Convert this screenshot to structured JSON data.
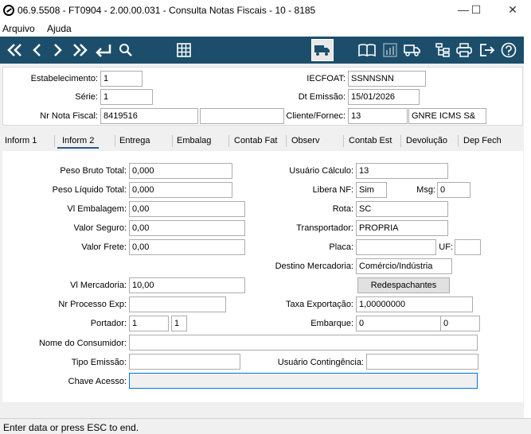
{
  "window": {
    "title": "06.9.5508 - FT0904 - 2.00.00.031 - Consulta Notas Fiscais - 10 - 8185",
    "minimize": "—",
    "maximize": "☐",
    "close": "✕"
  },
  "menu": {
    "arquivo": "Arquivo",
    "ajuda": "Ajuda"
  },
  "header": {
    "estabelecimento_label": "Estabelecimento:",
    "estabelecimento": "1",
    "serie_label": "Série:",
    "serie": "1",
    "nr_nota_label": "Nr Nota Fiscal:",
    "nr_nota": "8419516",
    "nr_nota_extra": "",
    "iecfoat_label": "IECFOAT:",
    "iecfoat": "SSNNSNN",
    "dt_emissao_label": "Dt Emissão:",
    "dt_emissao": "15/01/2026",
    "cliente_label": "Cliente/Fornec:",
    "cliente_code": "13",
    "cliente_name": "GNRE ICMS S&"
  },
  "tabs": [
    "Inform 1",
    "Inform 2",
    "Entrega",
    "Embalag",
    "Contab Fat",
    "Observ",
    "Contab Est",
    "Devolução",
    "Dep Fech"
  ],
  "form": {
    "peso_bruto_label": "Peso Bruto Total:",
    "peso_bruto": "0,000",
    "peso_liquido_label": "Peso Líquido Total:",
    "peso_liquido": "0,000",
    "vl_embalagem_label": "Vl Embalagem:",
    "vl_embalagem": "0,00",
    "valor_seguro_label": "Valor Seguro:",
    "valor_seguro": "0,00",
    "valor_frete_label": "Valor Frete:",
    "valor_frete": "0,00",
    "vl_mercadoria_label": "Vl Mercadoria:",
    "vl_mercadoria": "10,00",
    "nr_processo_label": "Nr Processo Exp:",
    "nr_processo": "",
    "portador_label": "Portador:",
    "portador_1": "1",
    "portador_2": "1",
    "nome_consumidor_label": "Nome do Consumidor:",
    "nome_consumidor": "",
    "tipo_emissao_label": "Tipo Emissão:",
    "tipo_emissao": "",
    "chave_acesso_label": "Chave Acesso:",
    "chave_acesso": "",
    "usuario_calculo_label": "Usuário Cálculo:",
    "usuario_calculo": "13",
    "libera_nf_label": "Libera NF:",
    "libera_nf": "Sim",
    "msg_label": "Msg:",
    "msg": "0",
    "rota_label": "Rota:",
    "rota": "SC",
    "transportador_label": "Transportador:",
    "transportador": "PROPRIA",
    "placa_label": "Placa:",
    "placa": "",
    "uf_label": "UF:",
    "uf": "",
    "destino_label": "Destino Mercadoria:",
    "destino": "Comércio/Indústria",
    "redespachantes_button": "Redespachantes",
    "taxa_exportacao_label": "Taxa Exportação:",
    "taxa_exportacao": "1,00000000",
    "embarque_label": "Embarque:",
    "embarque_1": "0",
    "embarque_2": "0",
    "usuario_contingencia_label": "Usuário Contingência:",
    "usuario_contingencia": ""
  },
  "status": {
    "message": "Enter data or press ESC to end."
  },
  "colors": {
    "toolbar": "#1c4e6b",
    "accent": "#0078d7"
  },
  "toolbar_icons": [
    "first-icon",
    "prev-icon",
    "next-icon",
    "last-icon",
    "goto-icon",
    "search-icon",
    "grid-icon",
    "truck-icon",
    "book-icon",
    "chart-icon",
    "delivery-icon",
    "tree-icon",
    "print-icon",
    "exit-icon",
    "help-icon"
  ]
}
